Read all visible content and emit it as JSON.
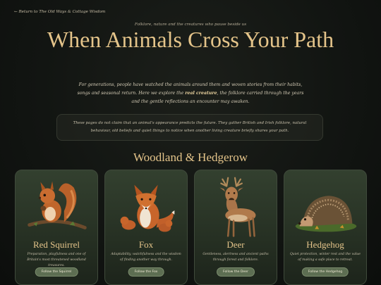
{
  "nav": {
    "back_label": "← Return to The Old Ways & Cottage Wisdom"
  },
  "hero": {
    "eyebrow": "Folklore, nature and the creatures who pause beside us",
    "title": "When Animals Cross Your Path",
    "intro_before": "For generations, people have watched the animals around them and woven stories from their habits, songs and seasonal return. Here we explore the ",
    "intro_bold": "real creature",
    "intro_after": ", the folklore carried through the years and the gentle reflections an encounter may awaken."
  },
  "note": {
    "text": "These pages do not claim that an animal's appearance predicts the future. They gather British and Irish folklore, natural behaviour, old beliefs and quiet things to notice when another living creature briefly shares your path."
  },
  "section": {
    "title": "Woodland & Hedgerow"
  },
  "cards": [
    {
      "name": "Red Squirrel",
      "desc": "Preparation, playfulness and one of Britain's most threatened woodland treasures.",
      "button": "Follow the Squirrel",
      "icon": "squirrel-illustration"
    },
    {
      "name": "Fox",
      "desc": "Adaptability, watchfulness and the wisdom of finding another way through.",
      "button": "Follow the Fox",
      "icon": "fox-illustration"
    },
    {
      "name": "Deer",
      "desc": "Gentleness, alertness and ancient paths through forest and folklore.",
      "button": "Follow the Deer",
      "icon": "deer-illustration"
    },
    {
      "name": "Hedgehog",
      "desc": "Quiet protection, winter rest and the value of making a safe place to retreat.",
      "button": "Follow the Hedgehog",
      "icon": "hedgehog-illustration"
    }
  ]
}
